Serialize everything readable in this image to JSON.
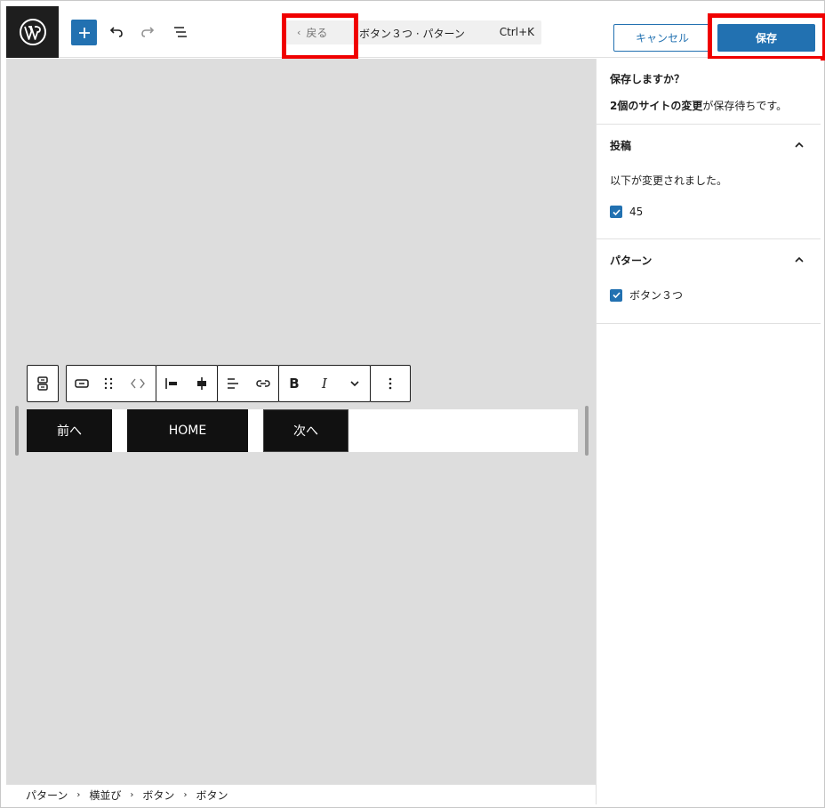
{
  "header": {
    "back_label": "戻る",
    "document_title": "ボタン３つ · パターン",
    "shortcut": "Ctrl+K",
    "cancel_label": "キャンセル",
    "save_label": "保存"
  },
  "buttons": [
    {
      "label": "前へ"
    },
    {
      "label": "HOME"
    },
    {
      "label": "次へ"
    }
  ],
  "breadcrumb": [
    "パターン",
    "横並び",
    "ボタン",
    "ボタン"
  ],
  "sidebar": {
    "title": "保存しますか？",
    "desc_bold": "2個のサイトの変更",
    "desc_rest": "が保存待ちです。",
    "panels": [
      {
        "heading": "投稿",
        "note": "以下が変更されました。",
        "items": [
          {
            "label": "45",
            "checked": true
          }
        ]
      },
      {
        "heading": "パターン",
        "items": [
          {
            "label": "ボタン３つ",
            "checked": true
          }
        ]
      }
    ]
  },
  "colors": {
    "accent": "#2271b1",
    "highlight": "#f00000",
    "canvas": "#dddddd",
    "button_bg": "#111111"
  },
  "icons": [
    "wordpress-logo-icon",
    "plus-icon",
    "undo-icon",
    "redo-icon",
    "list-view-icon",
    "chevron-left-icon",
    "chevron-up-icon",
    "check-icon"
  ]
}
